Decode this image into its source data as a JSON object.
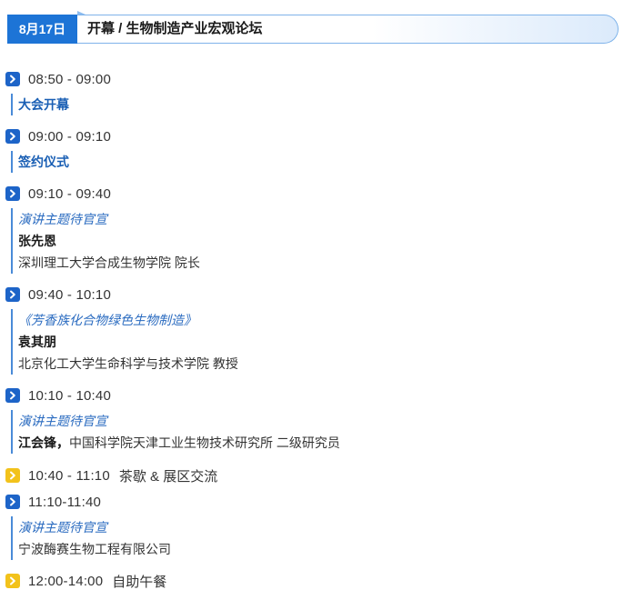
{
  "header": {
    "date": "8月17日",
    "title": "开幕 / 生物制造产业宏观论坛"
  },
  "agenda": [
    {
      "time": "08:50 - 09:00",
      "kind": "session",
      "lines": [
        "大会开幕"
      ]
    },
    {
      "time": "09:00 - 09:10",
      "kind": "session",
      "lines": [
        "签约仪式"
      ]
    },
    {
      "time": "09:10 - 09:40",
      "kind": "session",
      "talk": "演讲主题待官宣",
      "speaker": "张先恩",
      "affiliation": "深圳理工大学合成生物学院 院长"
    },
    {
      "time": "09:40 - 10:10",
      "kind": "session",
      "talk": "《芳香族化合物绿色生物制造》",
      "speaker": "袁其朋",
      "affiliation": "北京化工大学生命科学与技术学院 教授"
    },
    {
      "time": "10:10 - 10:40",
      "kind": "session",
      "talk": "演讲主题待官宣",
      "speaker": "江会锋，",
      "affiliation": "中国科学院天津工业生物技术研究所 二级研究员"
    },
    {
      "time": "10:40 - 11:10",
      "kind": "break",
      "note": "茶歇 & 展区交流"
    },
    {
      "time": "11:10-11:40",
      "kind": "session",
      "talk": "演讲主题待官宣",
      "affiliation": "宁波酶赛生物工程有限公司"
    },
    {
      "time": "12:00-14:00",
      "kind": "break",
      "note": "自助午餐"
    }
  ],
  "colors": {
    "accent_blue": "#1d64c8",
    "break_yellow": "#f2c21b",
    "link_blue": "#1a5fb4"
  },
  "icons": {
    "session": "chevron-right-icon",
    "break": "chevron-right-icon"
  }
}
